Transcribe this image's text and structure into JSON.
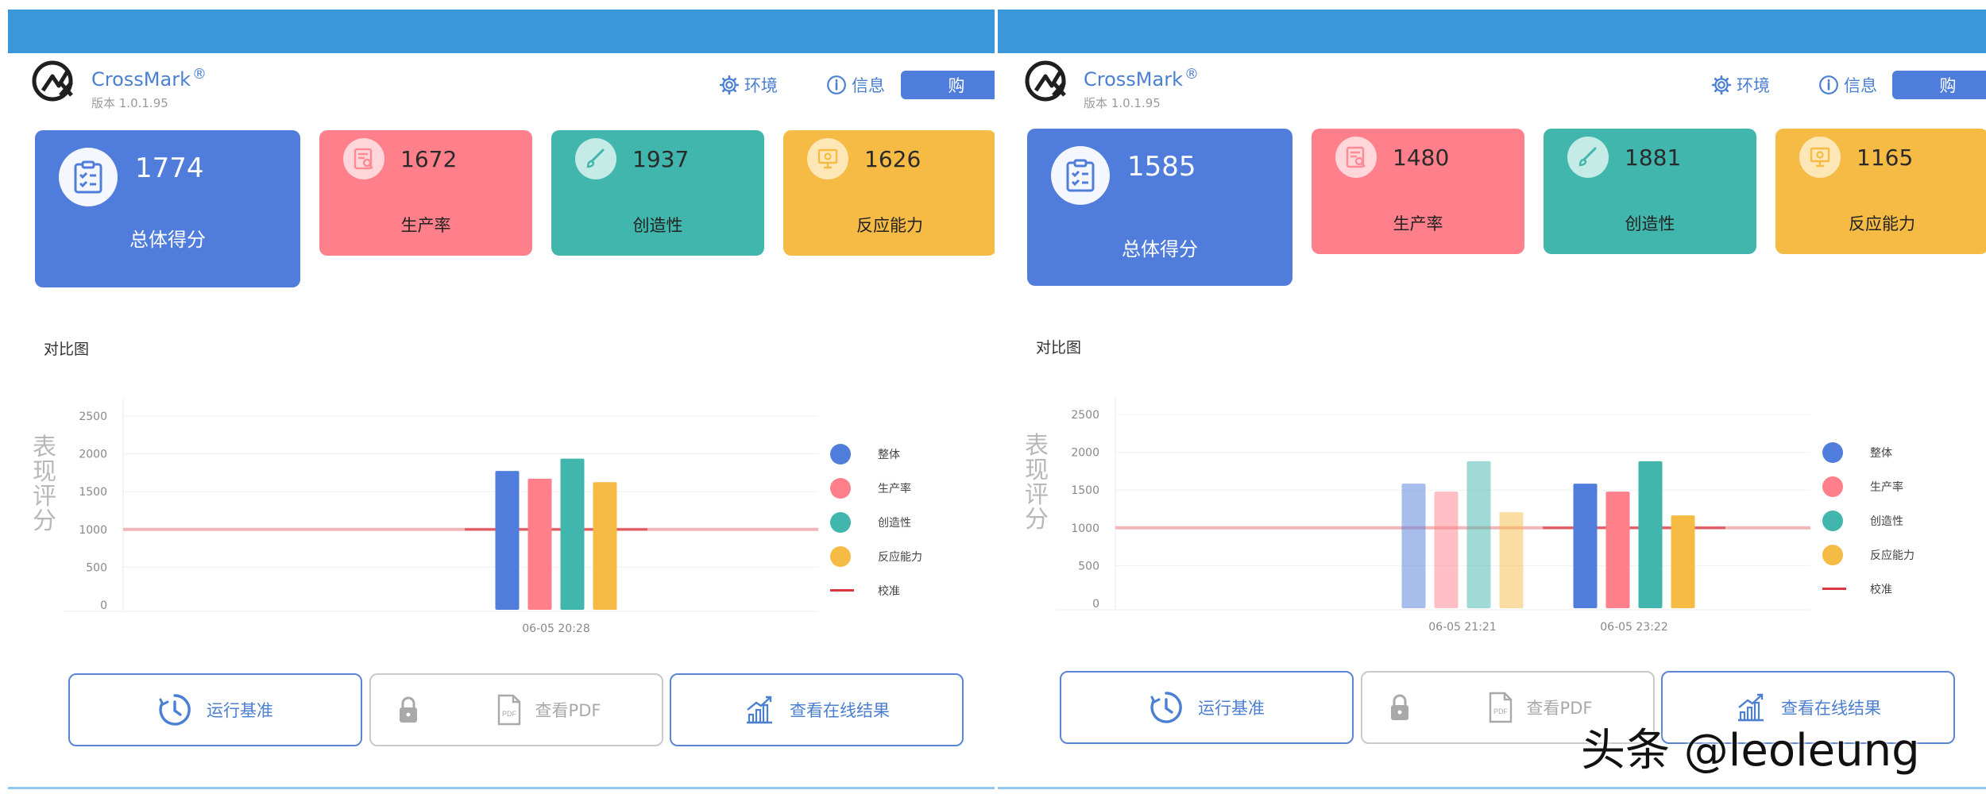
{
  "app": {
    "name": "CrossMark",
    "reg": "®",
    "version": "版本 1.0.1.95"
  },
  "header": {
    "env_label": "环境",
    "info_label": "信息",
    "buy_label": "购"
  },
  "colors": {
    "topbar": "#3a98da",
    "overall": "#507ddb",
    "productivity": "#ff7f8a",
    "creativity": "#40b6ad",
    "responsiveness": "#f5bb45",
    "calibration": "#d9363e"
  },
  "labels": {
    "overall": "总体得分",
    "productivity": "生产率",
    "creativity": "创造性",
    "responsiveness": "反应能力"
  },
  "section_title": "对比图",
  "buttons": {
    "run": "运行基准",
    "pdf": "查看PDF",
    "pdf_icon_text": "PDF",
    "online": "查看在线结果"
  },
  "panels": [
    {
      "scores": {
        "overall": "1774",
        "productivity": "1672",
        "creativity": "1937",
        "responsiveness": "1626"
      }
    },
    {
      "scores": {
        "overall": "1585",
        "productivity": "1480",
        "creativity": "1881",
        "responsiveness": "1165"
      }
    }
  ],
  "chart_data": [
    {
      "type": "bar",
      "ylabel": "表现评分",
      "yticks": [
        0,
        500,
        1000,
        1500,
        2000,
        2500
      ],
      "ylim": [
        0,
        2500
      ],
      "grid": true,
      "legend_position": "right",
      "categories": [
        "06-05 20:28"
      ],
      "series": [
        {
          "name": "整体",
          "values": [
            1774
          ]
        },
        {
          "name": "生产率",
          "values": [
            1672
          ]
        },
        {
          "name": "创造性",
          "values": [
            1937
          ]
        },
        {
          "name": "反应能力",
          "values": [
            1626
          ]
        }
      ],
      "reference_line": {
        "name": "校准",
        "value": 1000
      }
    },
    {
      "type": "bar",
      "ylabel": "表现评分",
      "yticks": [
        0,
        500,
        1000,
        1500,
        2000,
        2500
      ],
      "ylim": [
        0,
        2500
      ],
      "grid": true,
      "legend_position": "right",
      "categories": [
        "06-05 21:21",
        "06-05 23:22"
      ],
      "series": [
        {
          "name": "整体",
          "values": [
            1585,
            1585
          ]
        },
        {
          "name": "生产率",
          "values": [
            1480,
            1480
          ]
        },
        {
          "name": "创造性",
          "values": [
            1881,
            1881
          ]
        },
        {
          "name": "反应能力",
          "values": [
            1207,
            1165
          ]
        }
      ],
      "reference_line": {
        "name": "校准",
        "value": 1000
      }
    }
  ],
  "watermark": "头条 @leoleung"
}
